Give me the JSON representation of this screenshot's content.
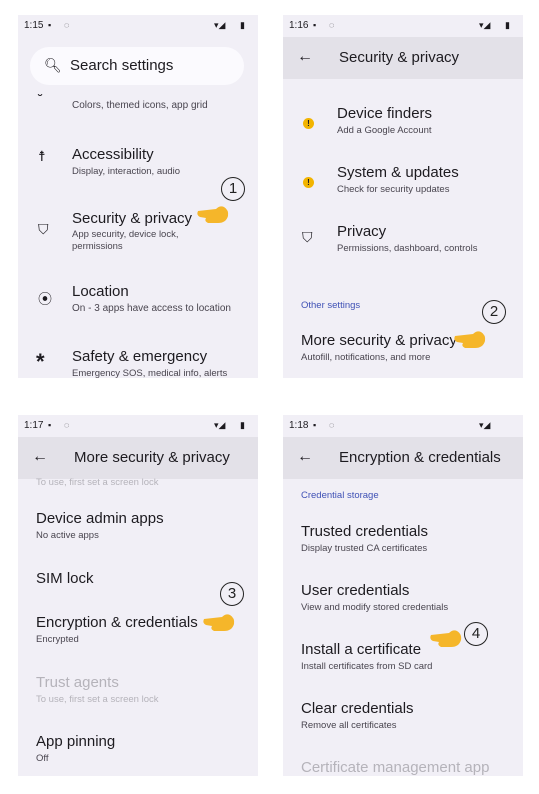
{
  "panels": [
    {
      "time": "1:15",
      "search_placeholder": "Search settings",
      "items": [
        {
          "subtitle": "Colors, themed icons, app grid",
          "icon": "palette-icon"
        },
        {
          "title": "Accessibility",
          "subtitle": "Display, interaction, audio",
          "icon": "accessibility-icon"
        },
        {
          "title": "Security & privacy",
          "subtitle": "App security, device lock,",
          "subtitle2": "permissions",
          "icon": "shield-icon"
        },
        {
          "title": "Location",
          "subtitle": "On - 3 apps have access to location",
          "icon": "location-pin-icon"
        },
        {
          "title": "Safety & emergency",
          "subtitle": "Emergency SOS, medical info, alerts",
          "icon": "asterisk-icon"
        }
      ],
      "step": "1"
    },
    {
      "time": "1:16",
      "header_title": "Security & privacy",
      "items": [
        {
          "title": "Device finders",
          "subtitle": "Add a Google Account",
          "icon": "warning-icon"
        },
        {
          "title": "System & updates",
          "subtitle": "Check for security updates",
          "icon": "warning-icon"
        },
        {
          "title": "Privacy",
          "subtitle": "Permissions, dashboard, controls",
          "icon": "privacy-shield-icon"
        }
      ],
      "section_label": "Other settings",
      "more_item": {
        "title": "More security & privacy",
        "subtitle": "Autofill, notifications, and more"
      },
      "step": "2"
    },
    {
      "time": "1:17",
      "header_title": "More security & privacy",
      "cut_text": "To use, first set a screen lock",
      "items": [
        {
          "title": "Device admin apps",
          "subtitle": "No active apps"
        },
        {
          "title": "SIM lock"
        },
        {
          "title": "Encryption & credentials",
          "subtitle": "Encrypted"
        },
        {
          "title": "Trust agents",
          "subtitle": "To use, first set a screen lock",
          "disabled": true
        },
        {
          "title": "App pinning",
          "subtitle": "Off"
        }
      ],
      "step": "3"
    },
    {
      "time": "1:18",
      "header_title": "Encryption & credentials",
      "section_label": "Credential storage",
      "items": [
        {
          "title": "Trusted credentials",
          "subtitle": "Display trusted CA certificates"
        },
        {
          "title": "User credentials",
          "subtitle": "View and modify stored credentials"
        },
        {
          "title": "Install a certificate",
          "subtitle": "Install certificates from SD card"
        },
        {
          "title": "Clear credentials",
          "subtitle": "Remove all certificates"
        },
        {
          "title": "Certificate management app",
          "disabled": true
        }
      ],
      "step": "4"
    }
  ],
  "colors": {
    "panel_bg": "#f1eff6",
    "header_bg": "#e3e1e8",
    "accent": "#3f51b5",
    "warning": "#f2b400",
    "hand": "#f5b62a"
  },
  "back_arrow": "←"
}
